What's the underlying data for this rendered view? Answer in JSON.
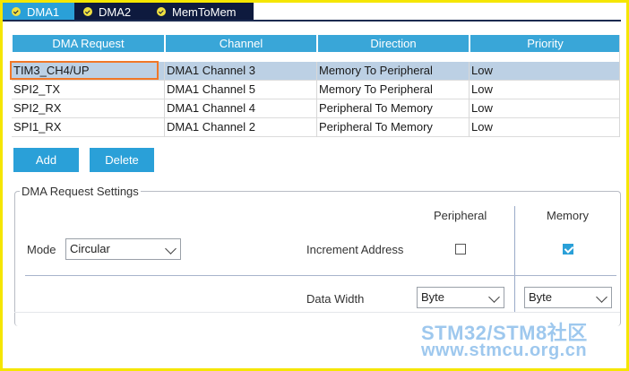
{
  "tabs": [
    {
      "label": "DMA1"
    },
    {
      "label": "DMA2"
    },
    {
      "label": "MemToMem"
    }
  ],
  "table": {
    "headers": [
      "DMA Request",
      "Channel",
      "Direction",
      "Priority"
    ],
    "rows": [
      [
        "TIM3_CH4/UP",
        "DMA1 Channel 3",
        "Memory To Peripheral",
        "Low"
      ],
      [
        "SPI2_TX",
        "DMA1 Channel 5",
        "Memory To Peripheral",
        "Low"
      ],
      [
        "SPI2_RX",
        "DMA1 Channel 4",
        "Peripheral To Memory",
        "Low"
      ],
      [
        "SPI1_RX",
        "DMA1 Channel 2",
        "Peripheral To Memory",
        "Low"
      ]
    ]
  },
  "buttons": {
    "add": "Add",
    "delete": "Delete"
  },
  "settings": {
    "title": "DMA Request Settings",
    "peripheral_header": "Peripheral",
    "memory_header": "Memory",
    "mode_label": "Mode",
    "mode_value": "Circular",
    "increment_label": "Increment Address",
    "peripheral_increment": false,
    "memory_increment": true,
    "data_width_label": "Data Width",
    "peripheral_width": "Byte",
    "memory_width": "Byte"
  },
  "watermark": {
    "line1": "STM32/STM8社区",
    "line2": "www.stmcu.org.cn"
  },
  "colors": {
    "accent": "#2aa0d8",
    "highlight": "#f07828",
    "frame": "#f5e600"
  }
}
